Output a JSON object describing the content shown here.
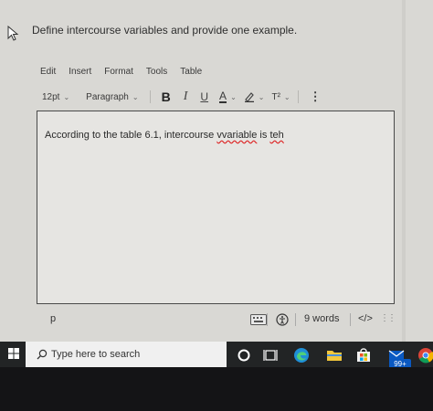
{
  "question": {
    "text": "Define intercourse variables and provide one example."
  },
  "menu": {
    "items": [
      "Edit",
      "Insert",
      "Format",
      "Tools",
      "Table"
    ]
  },
  "toolbar": {
    "font_size": "12pt",
    "paragraph": "Paragraph",
    "bold": "B",
    "italic": "I",
    "underline": "U",
    "font_color": "A",
    "superscript": "T²",
    "more": "⋮"
  },
  "editor": {
    "text_before": "According to the table 6.1, intercourse ",
    "misspelled_1": "vvariable",
    "text_middle": " is ",
    "misspelled_2": "teh"
  },
  "status": {
    "path": "p",
    "word_count": "9 words",
    "code_view": "</>",
    "drag": "⋮⋮"
  },
  "taskbar": {
    "search_placeholder": "Type here to search",
    "notification_count": "99+"
  },
  "colors": {
    "page_bg": "#d9d8d4",
    "editor_bg": "#e6e5e2",
    "taskbar_bg": "#222425",
    "spell_underline": "#dd2222"
  }
}
